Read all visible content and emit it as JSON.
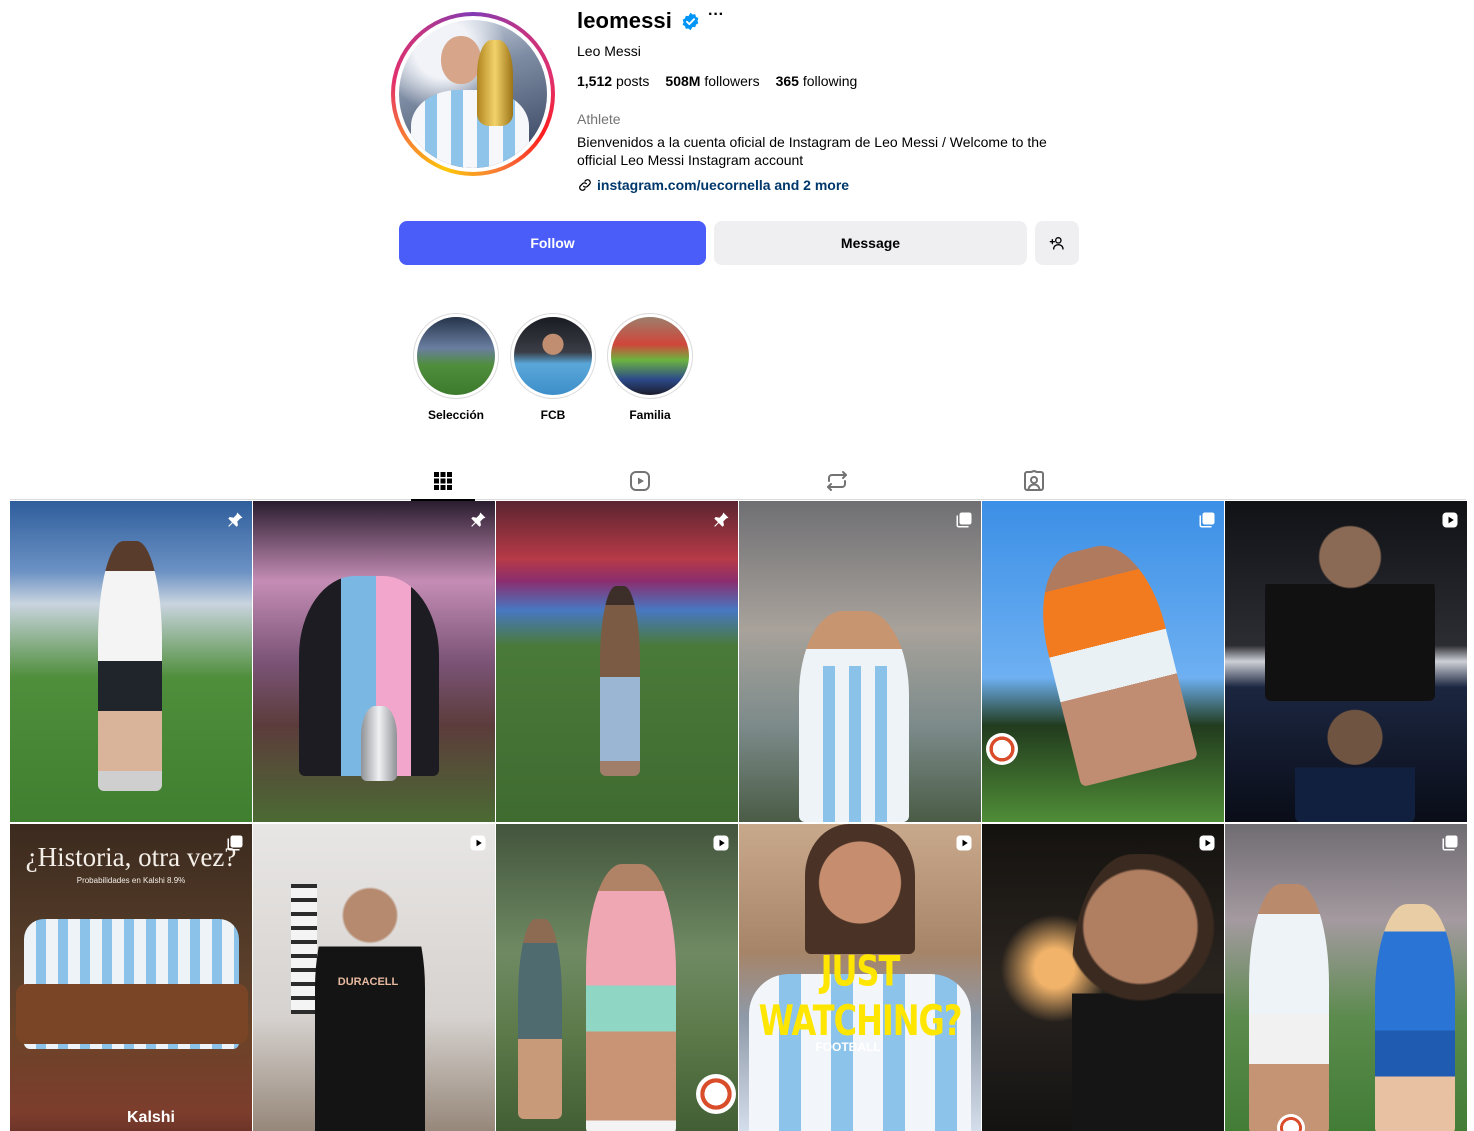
{
  "profile": {
    "username": "leomessi",
    "full_name": "Leo Messi",
    "stats": {
      "posts_count": "1,512",
      "posts_label": "posts",
      "followers_count": "508M",
      "followers_label": "followers",
      "following_count": "365",
      "following_label": "following"
    },
    "category": "Athlete",
    "bio": "Bienvenidos a la cuenta oficial de Instagram de Leo Messi / Welcome to the official Leo Messi Instagram account",
    "link_text": "instagram.com/uecornella and 2 more"
  },
  "actions": {
    "follow_label": "Follow",
    "message_label": "Message"
  },
  "highlights": [
    {
      "label": "Selección"
    },
    {
      "label": "FCB"
    },
    {
      "label": "Familia"
    }
  ],
  "tabs": [
    "posts-grid-icon",
    "reels-icon",
    "tagged-reposts-icon",
    "tagged-user-icon"
  ],
  "posts": {
    "tile7_title": "¿Historia, otra vez?",
    "tile7_sub": "Probabilidades en Kalshi 8.9%",
    "tile7_brand": "Kalshi",
    "tile8_shirt": "DURACELL",
    "tile10_caption": "JUST WATCHING?",
    "tile10_brand": "FOOTBALL"
  },
  "colors": {
    "follow_button": "#4a5df9",
    "secondary_button": "#efeff2",
    "link": "#00376b",
    "verified": "#0095f6",
    "muted": "#737373"
  }
}
